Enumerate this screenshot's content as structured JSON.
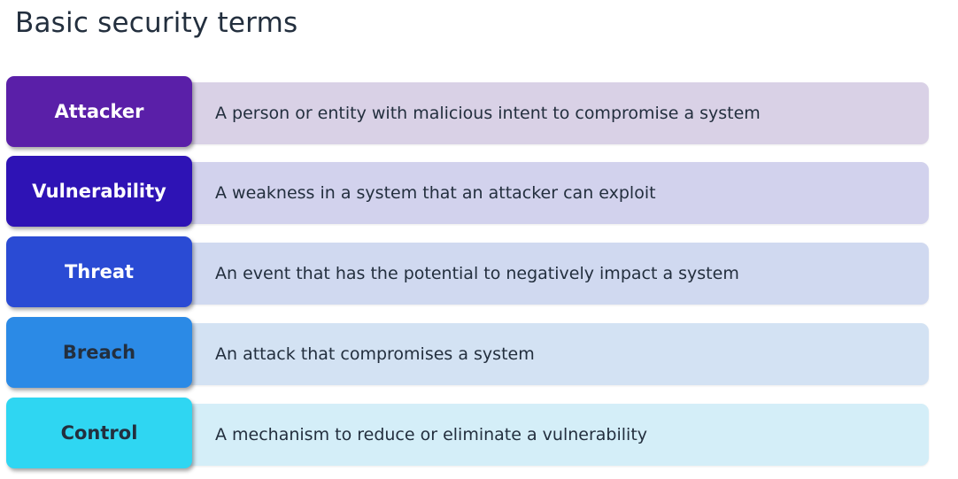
{
  "title": "Basic security terms",
  "terms": [
    {
      "term": "Attacker",
      "definition": "A person or entity with malicious intent to compromise a system",
      "term_color": "#5a1fa8",
      "term_text_color": "#ffffff",
      "desc_color": "#d9d1e6"
    },
    {
      "term": "Vulnerability",
      "definition": "A weakness in a system that an attacker can exploit",
      "term_color": "#2e13b5",
      "term_text_color": "#ffffff",
      "desc_color": "#d2d2ed"
    },
    {
      "term": "Threat",
      "definition": "An event that has the potential to negatively impact a system",
      "term_color": "#2a4bd4",
      "term_text_color": "#ffffff",
      "desc_color": "#d0d9f0"
    },
    {
      "term": "Breach",
      "definition": "An attack that compromises a system",
      "term_color": "#2b8ae6",
      "term_text_color": "#232f3e",
      "desc_color": "#d3e2f3"
    },
    {
      "term": "Control",
      "definition": "A mechanism to reduce or eliminate a vulnerability",
      "term_color": "#2fd6f2",
      "term_text_color": "#232f3e",
      "desc_color": "#d4eef8"
    }
  ]
}
